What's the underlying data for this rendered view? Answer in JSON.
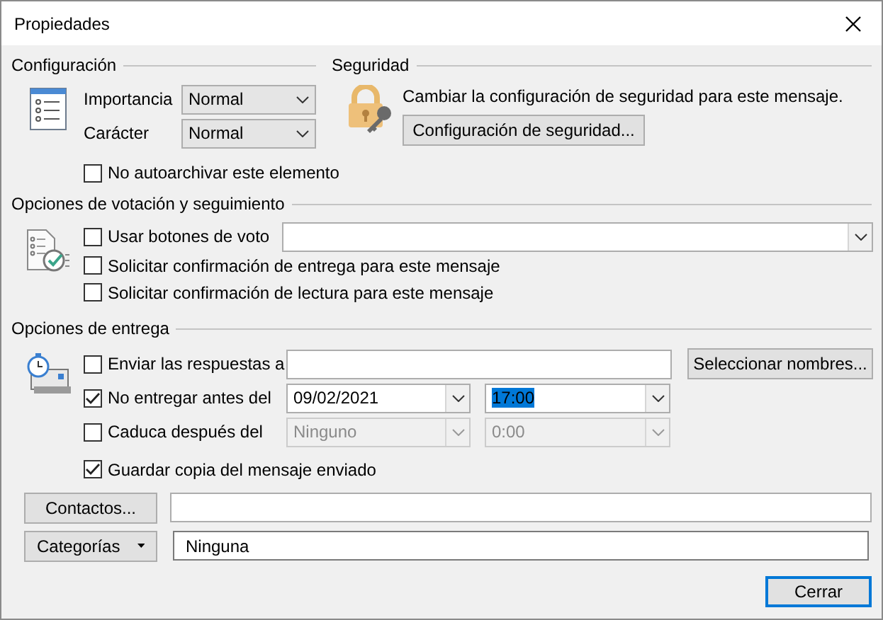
{
  "window": {
    "title": "Propiedades"
  },
  "configuracion": {
    "title": "Configuración",
    "fields": [
      {
        "label": "Importancia",
        "value": "Normal"
      },
      {
        "label": "Carácter",
        "value": "Normal"
      }
    ],
    "no_autoarchive": {
      "label": "No autoarchivar este elemento",
      "checked": false
    }
  },
  "seguridad": {
    "title": "Seguridad",
    "description": "Cambiar la configuración de seguridad para este mensaje.",
    "button": "Configuración de seguridad..."
  },
  "votacion": {
    "title": "Opciones de votación y seguimiento",
    "options": [
      {
        "kind": "combo",
        "label": "Usar botones de voto",
        "checked": false
      },
      {
        "kind": "plain",
        "label": "Solicitar confirmación de entrega para este mensaje",
        "checked": false
      },
      {
        "kind": "plain",
        "label": "Solicitar confirmación de lectura para este mensaje",
        "checked": false
      }
    ]
  },
  "entrega": {
    "title": "Opciones de entrega",
    "rows": [
      {
        "kind": "recipients",
        "label": "Enviar las respuestas a",
        "checked": false,
        "button": "Seleccionar nombres..."
      },
      {
        "kind": "datetime",
        "label": "No entregar antes del",
        "checked": true,
        "date": "09/02/2021",
        "time": "17:00",
        "disabled": false,
        "time_highlighted": true
      },
      {
        "kind": "datetime",
        "label": "Caduca después del",
        "checked": false,
        "date": "Ninguno",
        "time": "0:00",
        "disabled": true,
        "time_highlighted": false
      }
    ],
    "save_copy": {
      "label": "Guardar copia del mensaje enviado",
      "checked": true
    }
  },
  "contacts": {
    "button": "Contactos..."
  },
  "categories": {
    "button": "Categorías",
    "value": "Ninguna"
  },
  "close_button": "Cerrar"
}
